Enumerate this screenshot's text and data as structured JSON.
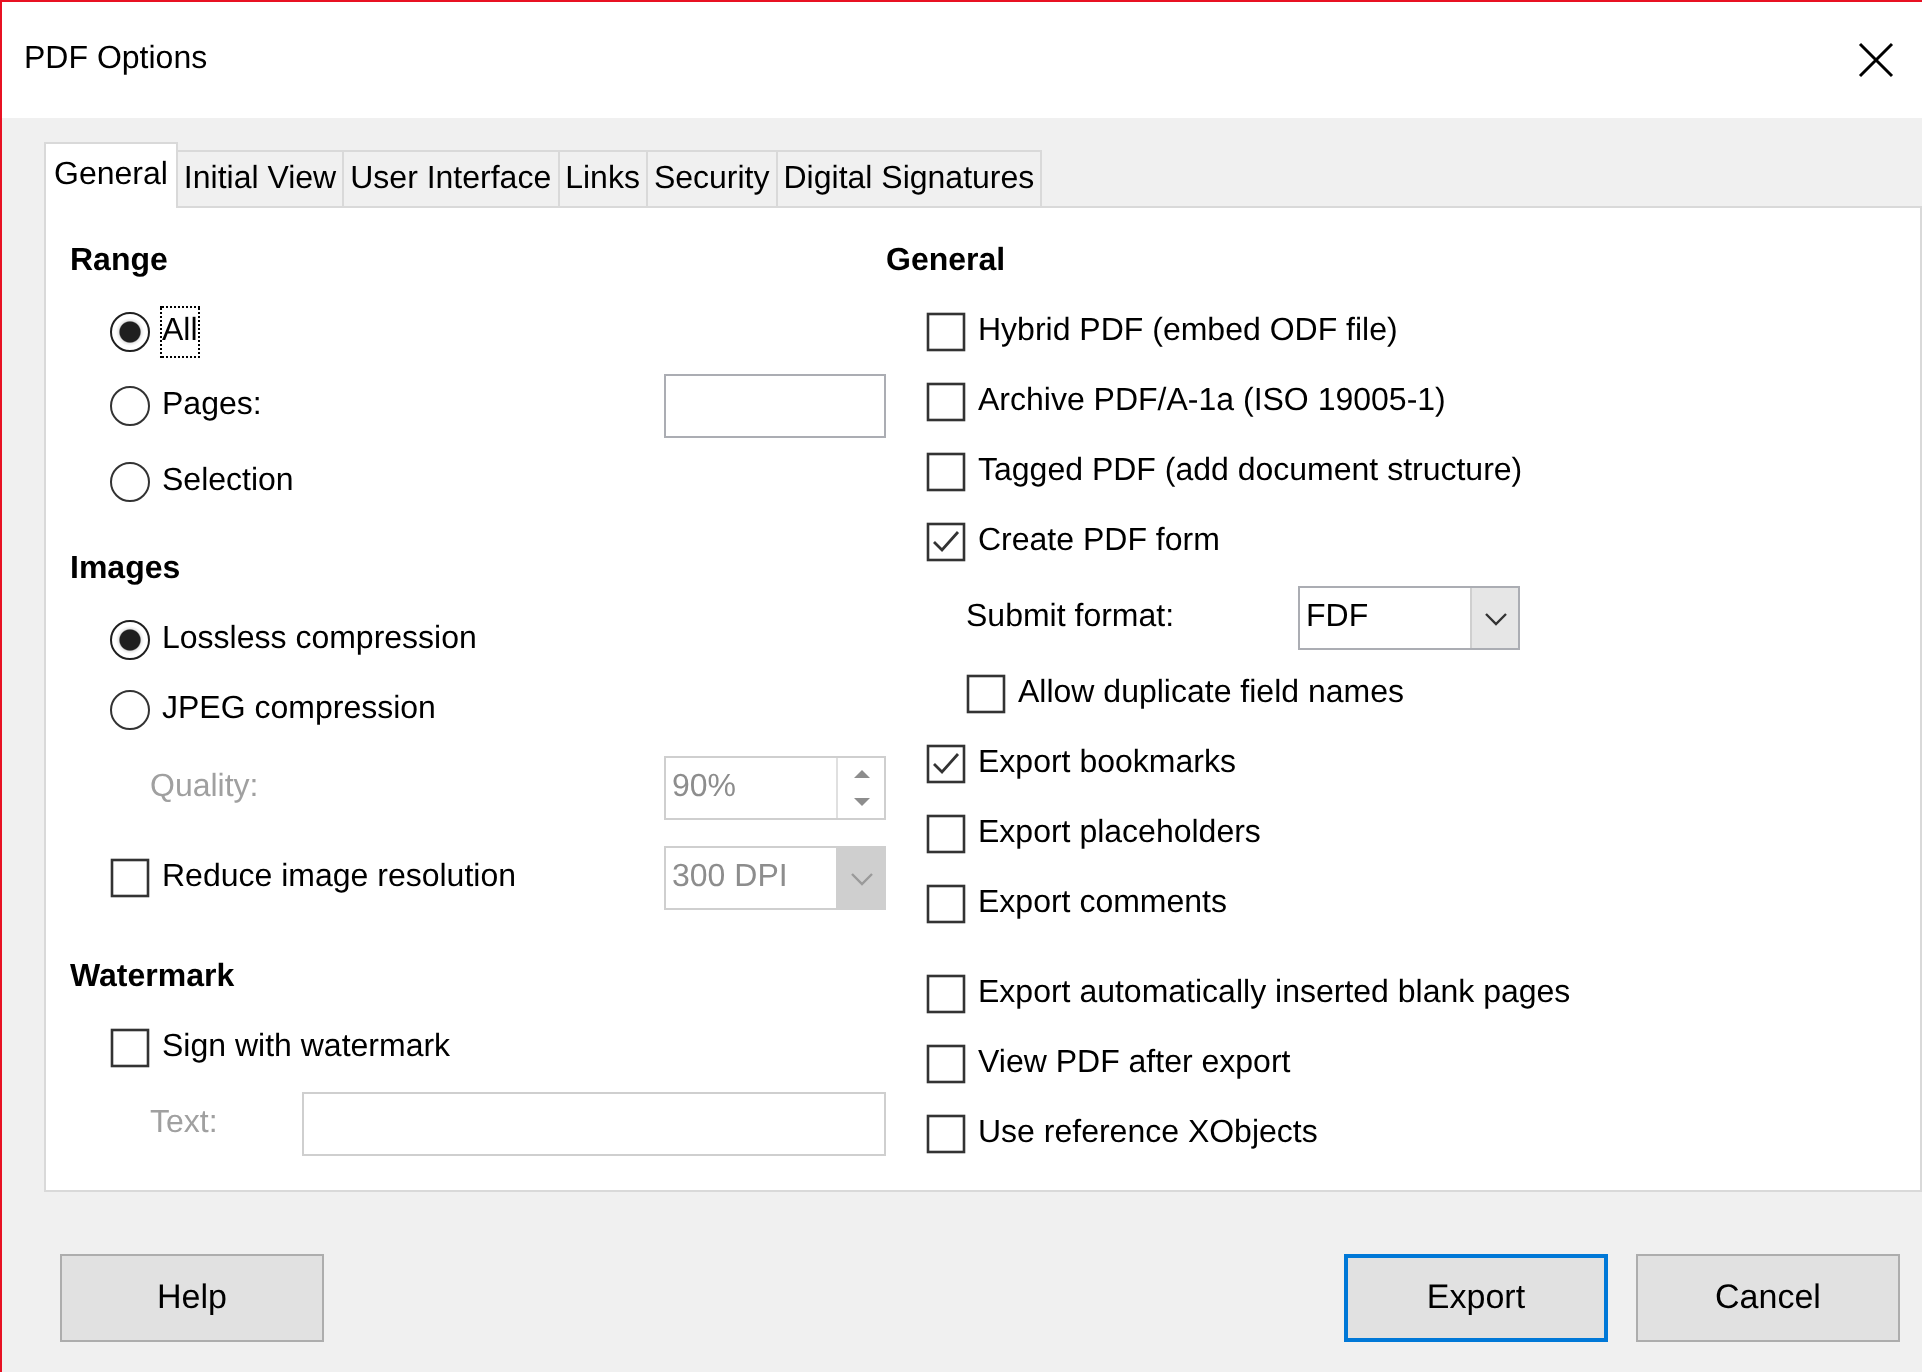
{
  "window": {
    "title": "PDF Options"
  },
  "tabs": [
    {
      "label": "General",
      "selected": true
    },
    {
      "label": "Initial View",
      "selected": false
    },
    {
      "label": "User Interface",
      "selected": false
    },
    {
      "label": "Links",
      "selected": false
    },
    {
      "label": "Security",
      "selected": false
    },
    {
      "label": "Digital Signatures",
      "selected": false
    }
  ],
  "range": {
    "heading": "Range",
    "options": [
      {
        "label": "All",
        "selected": true,
        "focused": true
      },
      {
        "label": "Pages:",
        "selected": false,
        "field": true
      },
      {
        "label": "Selection",
        "selected": false
      }
    ]
  },
  "images": {
    "heading": "Images",
    "options": [
      {
        "label": "Lossless compression",
        "selected": true
      },
      {
        "label": "JPEG compression",
        "selected": false
      }
    ],
    "quality": {
      "label": "Quality:",
      "value": "90%",
      "disabled": true
    },
    "reduce_resolution": {
      "label": "Reduce image resolution",
      "checked": false,
      "value": "300 DPI",
      "disabled": true
    }
  },
  "watermark": {
    "heading": "Watermark",
    "sign": {
      "label": "Sign with watermark",
      "checked": false
    },
    "text": {
      "label": "Text:",
      "disabled": true
    }
  },
  "general": {
    "heading": "General",
    "items": [
      {
        "kind": "checkbox",
        "label": "Hybrid PDF (embed ODF file)",
        "checked": false
      },
      {
        "kind": "checkbox",
        "label": "Archive PDF/A-1a (ISO 19005-1)",
        "checked": false
      },
      {
        "kind": "checkbox",
        "label": "Tagged PDF (add document structure)",
        "checked": false
      },
      {
        "kind": "checkbox",
        "label": "Create PDF form",
        "checked": true,
        "children": [
          {
            "kind": "select",
            "label": "Submit format:",
            "value": "FDF"
          },
          {
            "kind": "checkbox",
            "label": "Allow duplicate field names",
            "checked": false
          }
        ]
      },
      {
        "kind": "checkbox",
        "label": "Export bookmarks",
        "checked": true
      },
      {
        "kind": "checkbox",
        "label": "Export placeholders",
        "checked": false
      },
      {
        "kind": "checkbox",
        "label": "Export comments",
        "checked": false
      }
    ],
    "more_items": [
      {
        "kind": "checkbox",
        "label": "Export automatically inserted blank pages",
        "checked": false
      },
      {
        "kind": "checkbox",
        "label": "View PDF after export",
        "checked": false
      },
      {
        "kind": "checkbox",
        "label": "Use reference XObjects",
        "checked": false
      }
    ]
  },
  "buttons": [
    {
      "label": "Help",
      "default": false
    },
    {
      "label": "Export",
      "default": true
    },
    {
      "label": "Cancel",
      "default": false
    }
  ]
}
